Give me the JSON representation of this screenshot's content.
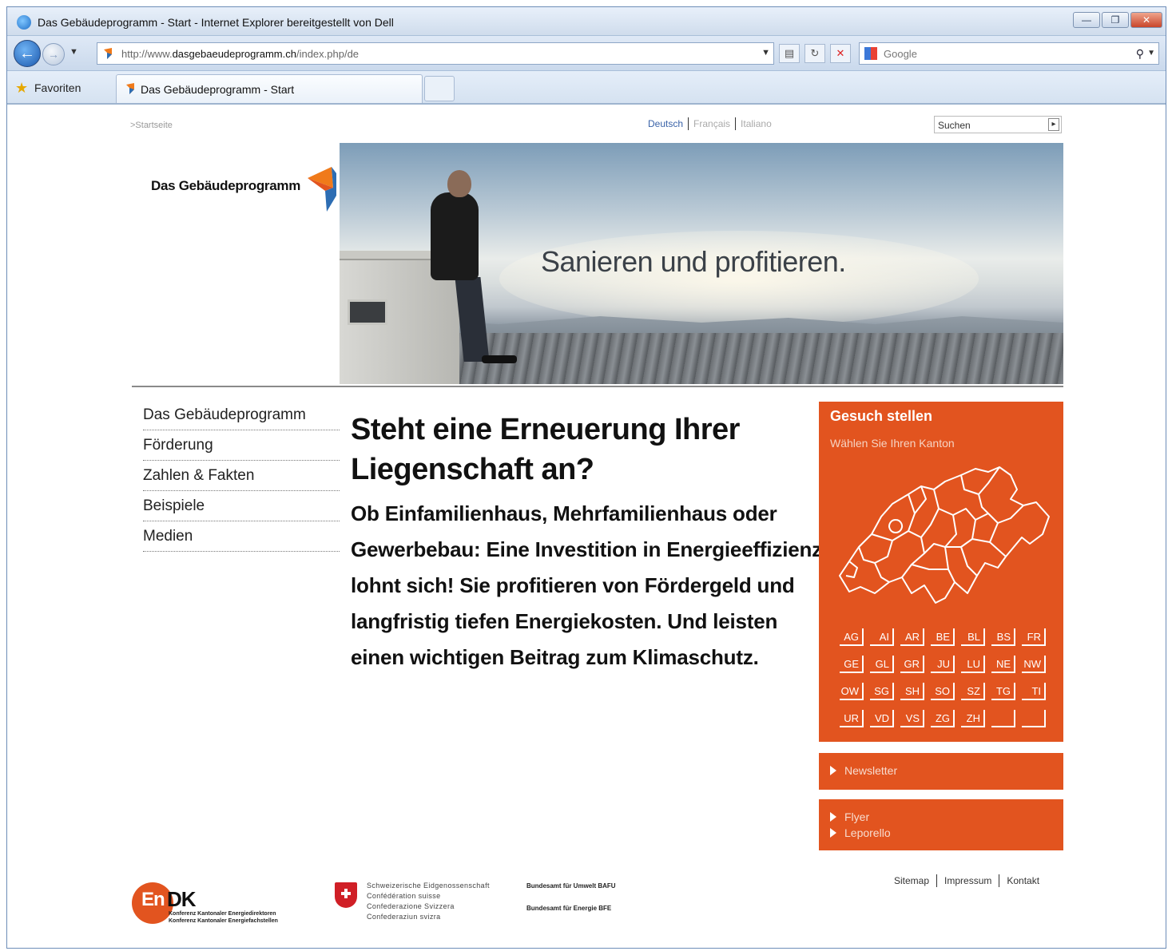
{
  "browser": {
    "window_title": "Das Gebäudeprogramm - Start - Internet Explorer bereitgestellt von Dell",
    "url_prefix": "http://www.",
    "url_domain": "dasgebaeudeprogramm.ch",
    "url_path": "/index.php/de",
    "search_placeholder": "Google",
    "favorites_label": "Favoriten",
    "tab_title": "Das Gebäudeprogramm - Start"
  },
  "page": {
    "breadcrumb": ">Startseite",
    "languages": [
      "Deutsch",
      "Français",
      "Italiano"
    ],
    "search_placeholder": "Suchen",
    "logo_text": "Das Gebäudeprogramm",
    "hero_slogan": "Sanieren und profitieren.",
    "nav": [
      "Das Gebäudeprogramm",
      "Förderung",
      "Zahlen & Fakten",
      "Beispiele",
      "Medien"
    ],
    "headline": "Steht eine Erneuerung Ihrer Liegenschaft an?",
    "lead": "Ob Einfamilienhaus, Mehrfamilienhaus oder Gewerbebau: Eine Investition in Energieeffizienz lohnt sich! Sie profitieren von Fördergeld und langfristig tiefen Energiekosten. Und leisten einen wichti­gen Beitrag zum Klimaschutz.",
    "gesuch": {
      "title": "Gesuch stellen",
      "subtitle": "Wählen Sie Ihren Kanton",
      "kantone": [
        "AG",
        "AI",
        "AR",
        "BE",
        "BL",
        "BS",
        "FR",
        "GE",
        "GL",
        "GR",
        "JU",
        "LU",
        "NE",
        "NW",
        "OW",
        "SG",
        "SH",
        "SO",
        "SZ",
        "TG",
        "TI",
        "UR",
        "VD",
        "VS",
        "ZG",
        "ZH",
        "",
        ""
      ]
    },
    "newsletter": "Newsletter",
    "flyer": "Flyer",
    "leporello": "Leporello",
    "footer": {
      "endk_en": "En",
      "endk_dk": "DK",
      "endk_line1": "Konferenz Kantonaler Energiedirektoren",
      "endk_line2": "Konferenz Kantonaler Energiefachstellen",
      "swiss_lines": [
        "Schweizerische Eidgenossenschaft",
        "Confédération suisse",
        "Confederazione Svizzera",
        "Confederaziun svizra"
      ],
      "bafu": "Bundesamt für Umwelt BAFU",
      "bfe": "Bundesamt für Energie BFE",
      "links": [
        "Sitemap",
        "Impressum",
        "Kontakt"
      ]
    }
  },
  "colors": {
    "accent_orange": "#e2541f",
    "logo_blue": "#2d6db3",
    "logo_orange": "#f07a1a"
  }
}
